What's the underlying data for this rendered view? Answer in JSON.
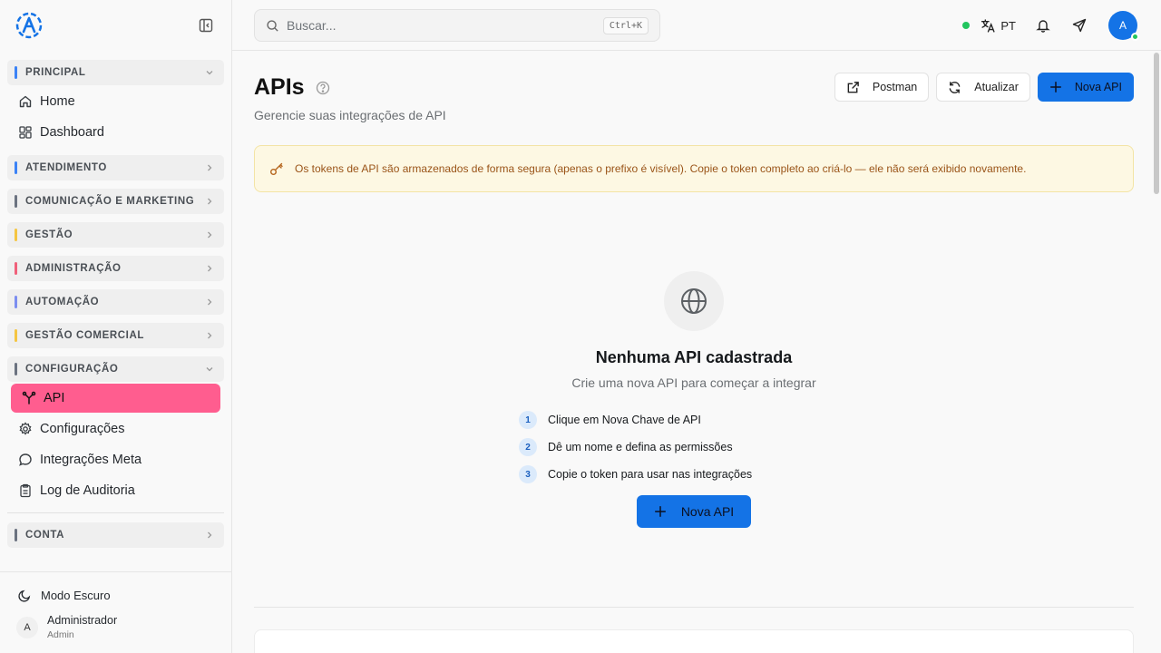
{
  "sidebar": {
    "sections": [
      {
        "label": "PRINCIPAL",
        "color": "#3b82f6",
        "expanded": true
      },
      {
        "label": "ATENDIMENTO",
        "color": "#3b82f6"
      },
      {
        "label": "COMUNICAÇÃO E MARKETING",
        "color": "#6b7280"
      },
      {
        "label": "GESTÃO",
        "color": "#f5c542"
      },
      {
        "label": "ADMINISTRAÇÃO",
        "color": "#f0607a"
      },
      {
        "label": "AUTOMAÇÃO",
        "color": "#7c8ef0"
      },
      {
        "label": "GESTÃO COMERCIAL",
        "color": "#f5c542"
      },
      {
        "label": "CONFIGURAÇÃO",
        "color": "#6b7280",
        "expanded": true
      },
      {
        "label": "CONTA",
        "color": "#6b7280"
      }
    ],
    "principal_items": [
      {
        "label": "Home",
        "icon": "home-icon"
      },
      {
        "label": "Dashboard",
        "icon": "dashboard-icon"
      }
    ],
    "config_items": [
      {
        "label": "API",
        "icon": "api-icon",
        "active": true
      },
      {
        "label": "Configurações",
        "icon": "settings-icon"
      },
      {
        "label": "Integrações Meta",
        "icon": "chat-icon"
      },
      {
        "label": "Log de Auditoria",
        "icon": "clipboard-icon"
      }
    ],
    "dark_mode_label": "Modo Escuro",
    "user": {
      "initial": "A",
      "name": "Administrador",
      "role": "Admin"
    }
  },
  "header": {
    "search_placeholder": "Buscar...",
    "search_shortcut": "Ctrl+K",
    "language": "PT",
    "avatar_initial": "A"
  },
  "main": {
    "title": "APIs",
    "subtitle": "Gerencie suas integrações de API",
    "actions": {
      "postman": "Postman",
      "refresh": "Atualizar",
      "new_api": "Nova API"
    },
    "alert": "Os tokens de API são armazenados de forma segura (apenas o prefixo é visível). Copie o token completo ao criá-lo — ele não será exibido novamente.",
    "empty": {
      "title": "Nenhuma API cadastrada",
      "subtitle": "Crie uma nova API para começar a integrar",
      "steps": [
        {
          "num": "1",
          "text": "Clique em Nova Chave de API"
        },
        {
          "num": "2",
          "text": "Dê um nome e defina as permissões"
        },
        {
          "num": "3",
          "text": "Copie o token para usar nas integrações"
        }
      ],
      "button": "Nova API"
    }
  },
  "colors": {
    "accent": "#1473e6",
    "active_nav": "#ff5d8f",
    "alert_bg": "#fdf8e3",
    "online": "#22c55e"
  }
}
